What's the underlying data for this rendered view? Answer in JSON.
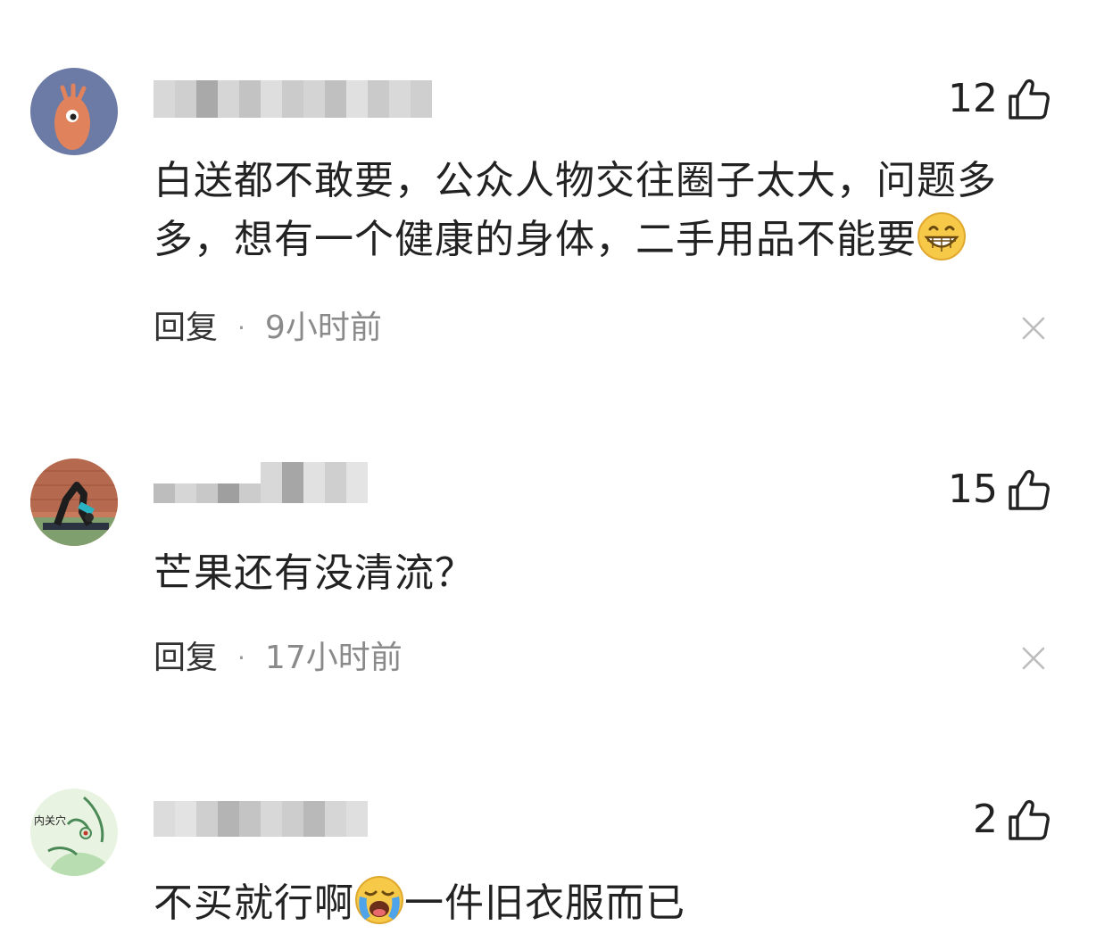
{
  "comments": [
    {
      "like_count": "12",
      "text": "白送都不敢要，公众人物交往圈子太大，问题多多，想有一个健康的身体，二手用品不能要",
      "emoji": "grinning-face-emoji",
      "reply_label": "回复",
      "separator": "·",
      "time": "9小时前"
    },
    {
      "like_count": "15",
      "text": "芒果还有没清流？",
      "reply_label": "回复",
      "separator": "·",
      "time": "17小时前"
    },
    {
      "like_count": "2",
      "text_before_emoji": "不买就行啊",
      "emoji": "loudly-crying-face-emoji",
      "text_after_emoji": "一件旧衣服而已",
      "avatar_caption": "内关穴"
    }
  ],
  "icons": {
    "like": "thumbs-up-icon",
    "close": "close-icon"
  },
  "colors": {
    "text_primary": "#222222",
    "text_meta": "#8a8a8a",
    "icon_gray": "#bdbdbd"
  }
}
